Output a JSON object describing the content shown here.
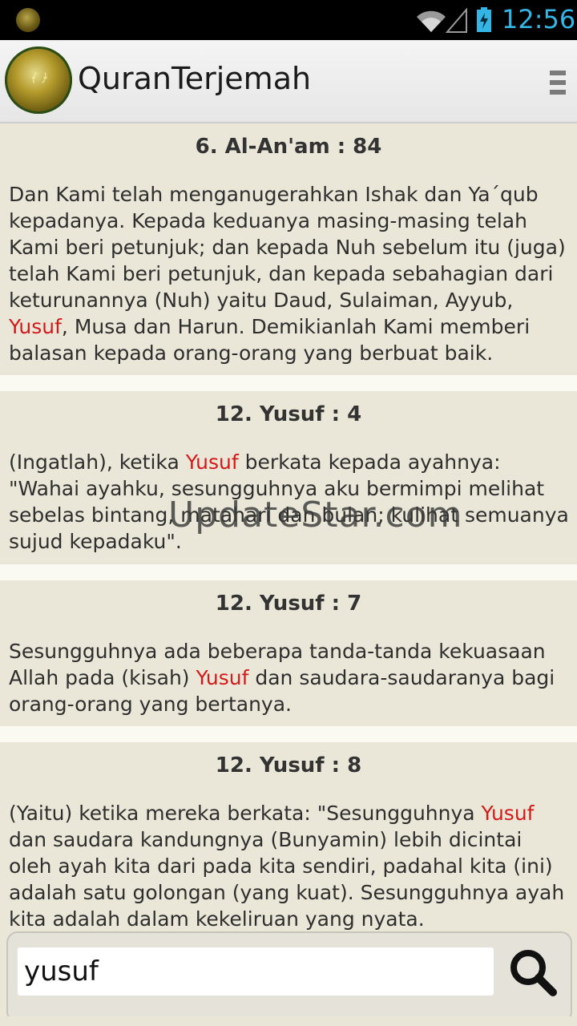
{
  "statusbar": {
    "time": "12:56"
  },
  "app": {
    "title": "QuranTerjemah"
  },
  "verses": [
    {
      "ref": "6. Al-An'am : 84",
      "before": "Dan Kami telah menganugerahkan Ishak dan Ya´qub kepadanya. Kepada keduanya masing-masing telah Kami beri petunjuk; dan kepada Nuh sebelum itu (juga) telah Kami beri petunjuk, dan kepada sebahagian dari keturunannya (Nuh) yaitu Daud, Sulaiman, Ayyub, ",
      "highlight": "Yusuf",
      "after": ", Musa dan Harun. Demikianlah Kami memberi balasan kepada orang-orang yang berbuat baik."
    },
    {
      "ref": "12. Yusuf : 4",
      "before": "(Ingatlah), ketika ",
      "highlight": "Yusuf",
      "after": " berkata kepada ayahnya: \"Wahai ayahku, sesungguhnya aku bermimpi melihat sebelas bintang, matahari dan bulan; kulihat semuanya sujud kepadaku\"."
    },
    {
      "ref": "12. Yusuf : 7",
      "before": "Sesungguhnya ada beberapa tanda-tanda kekuasaan Allah pada (kisah) ",
      "highlight": "Yusuf",
      "after": " dan saudara-saudaranya bagi orang-orang yang bertanya."
    },
    {
      "ref": "12. Yusuf : 8",
      "before": "(Yaitu) ketika mereka berkata: \"Sesungguhnya ",
      "highlight": "Yusuf",
      "after": " dan saudara kandungnya (Bunyamin) lebih dicintai oleh ayah kita dari pada kita sendiri, padahal kita (ini) adalah satu golongan (yang kuat). Sesungguhnya ayah kita adalah dalam kekeliruan yang nyata."
    }
  ],
  "watermark": "UpdateStar.com",
  "search": {
    "value": "yusuf"
  },
  "colors": {
    "highlight": "#d21a1a",
    "clock": "#33b5e5"
  }
}
